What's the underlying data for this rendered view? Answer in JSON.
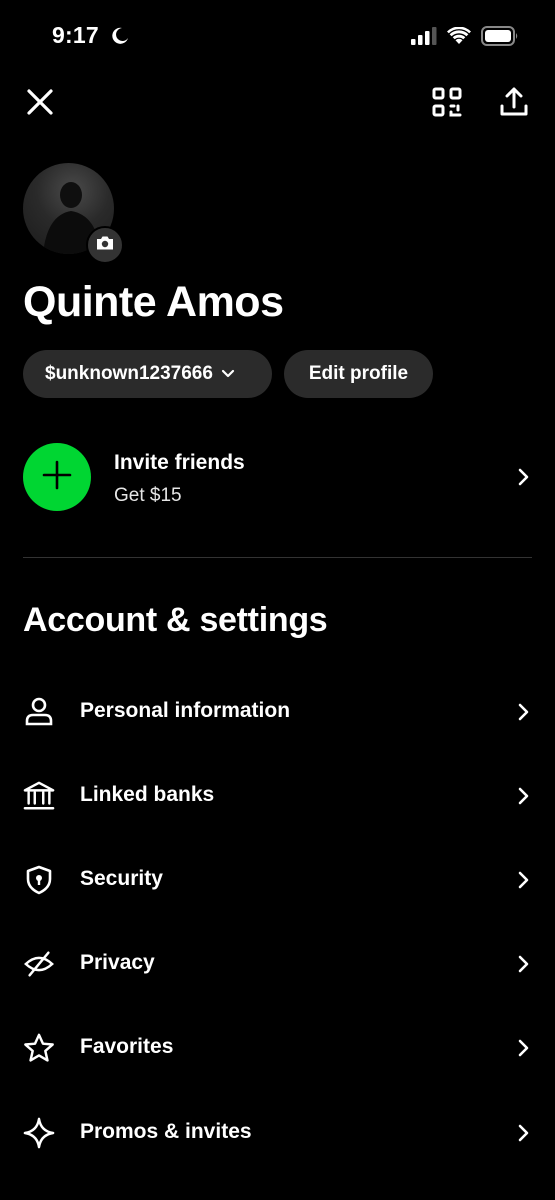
{
  "status_bar": {
    "time": "9:17",
    "icons": [
      "moon-icon",
      "cellular-signal-icon",
      "wifi-icon",
      "battery-icon"
    ]
  },
  "header": {
    "icons": [
      "close-icon",
      "qr-code-icon",
      "share-icon"
    ]
  },
  "profile": {
    "name": "Quinte Amos",
    "cashtag": "$unknown1237666",
    "edit_label": "Edit profile"
  },
  "invite": {
    "title": "Invite friends",
    "subtitle": "Get $15",
    "accent_color": "#00d632"
  },
  "settings": {
    "title": "Account & settings",
    "items": [
      {
        "label": "Personal information",
        "icon": "person-icon"
      },
      {
        "label": "Linked banks",
        "icon": "bank-icon"
      },
      {
        "label": "Security",
        "icon": "shield-icon"
      },
      {
        "label": "Privacy",
        "icon": "eye-slash-icon"
      },
      {
        "label": "Favorites",
        "icon": "star-icon"
      },
      {
        "label": "Promos & invites",
        "icon": "sparkle-icon"
      }
    ]
  }
}
